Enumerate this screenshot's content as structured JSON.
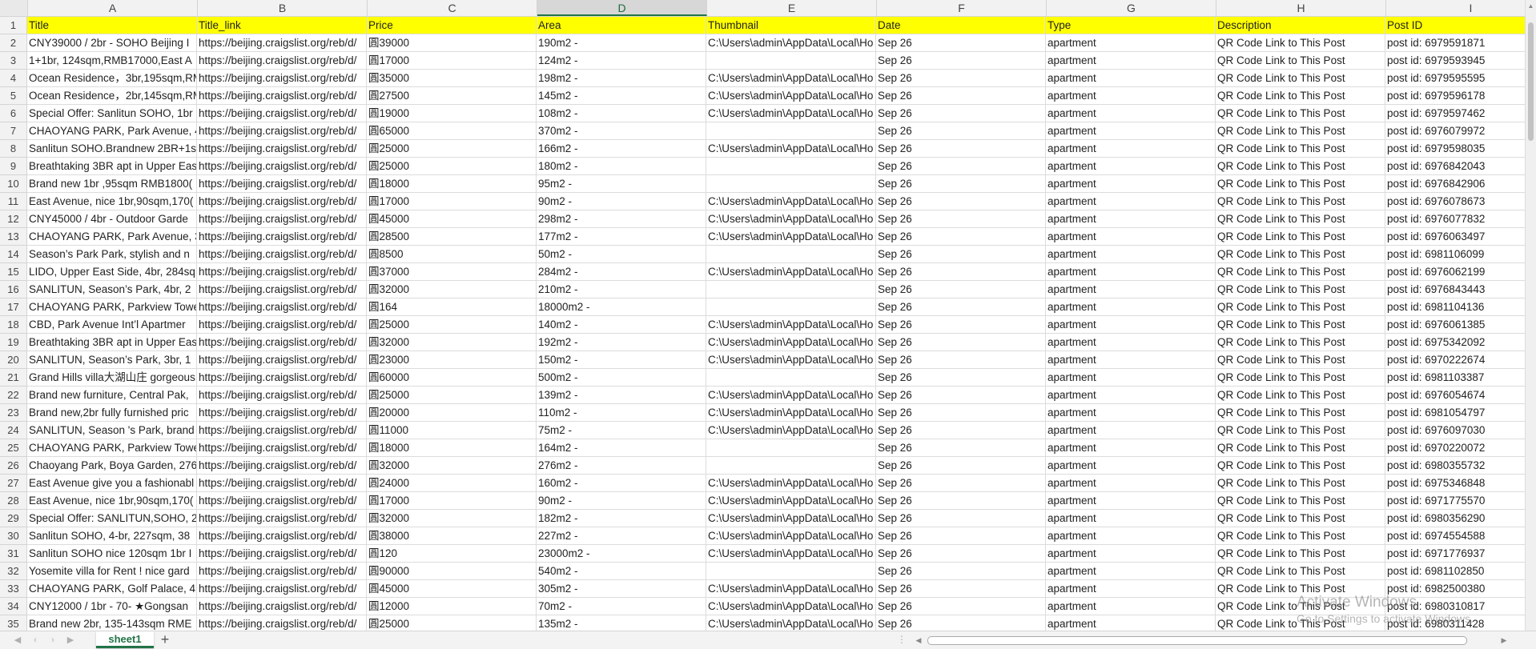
{
  "columns": [
    "A",
    "B",
    "C",
    "D",
    "E",
    "F",
    "G",
    "H",
    "I"
  ],
  "header_row": [
    "Title",
    "Title_link",
    "Price",
    "Area",
    "Thumbnail",
    "Date",
    "Type",
    "Description",
    "Post ID"
  ],
  "rows": [
    [
      "2",
      "CNY39000 / 2br - SOHO Beijing I",
      "https://beijing.craigslist.org/reb/d/",
      "圓39000",
      "190m2 -",
      "C:\\Users\\admin\\AppData\\Local\\Ho",
      "Sep 26",
      "apartment",
      "QR Code Link to This Post",
      "post id: 6979591871"
    ],
    [
      "3",
      "1+1br, 124sqm,RMB17000,East A",
      "https://beijing.craigslist.org/reb/d/",
      "圓17000",
      "124m2 -",
      "",
      "Sep 26",
      "apartment",
      "QR Code Link to This Post",
      "post id: 6979593945"
    ],
    [
      "4",
      "Ocean Residence，3br,195sqm,RM",
      "https://beijing.craigslist.org/reb/d/",
      "圓35000",
      "198m2 -",
      "C:\\Users\\admin\\AppData\\Local\\Ho",
      "Sep 26",
      "apartment",
      "QR Code Link to This Post",
      "post id: 6979595595"
    ],
    [
      "5",
      "Ocean Residence，2br,145sqm,RM",
      "https://beijing.craigslist.org/reb/d/",
      "圓27500",
      "145m2 -",
      "C:\\Users\\admin\\AppData\\Local\\Ho",
      "Sep 26",
      "apartment",
      "QR Code Link to This Post",
      "post id: 6979596178"
    ],
    [
      "6",
      "Special Offer: Sanlitun SOHO, 1br",
      "https://beijing.craigslist.org/reb/d/",
      "圓19000",
      "108m2 -",
      "C:\\Users\\admin\\AppData\\Local\\Ho",
      "Sep 26",
      "apartment",
      "QR Code Link to This Post",
      "post id: 6979597462"
    ],
    [
      "7",
      "CHAOYANG PARK, Park Avenue, 4",
      "https://beijing.craigslist.org/reb/d/",
      "圓65000",
      "370m2 -",
      "",
      "Sep 26",
      "apartment",
      "QR Code Link to This Post",
      "post id: 6976079972"
    ],
    [
      "8",
      "Sanlitun SOHO.Brandnew 2BR+1s",
      "https://beijing.craigslist.org/reb/d/",
      "圓25000",
      "166m2 -",
      "C:\\Users\\admin\\AppData\\Local\\Ho",
      "Sep 26",
      "apartment",
      "QR Code Link to This Post",
      "post id: 6979598035"
    ],
    [
      "9",
      "Breathtaking 3BR apt in Upper Eas",
      "https://beijing.craigslist.org/reb/d/",
      "圓25000",
      "180m2 -",
      "",
      "Sep 26",
      "apartment",
      "QR Code Link to This Post",
      "post id: 6976842043"
    ],
    [
      "10",
      "Brand new 1br ,95sqm RMB1800(",
      "https://beijing.craigslist.org/reb/d/",
      "圓18000",
      "95m2 -",
      "",
      "Sep 26",
      "apartment",
      "QR Code Link to This Post",
      "post id: 6976842906"
    ],
    [
      "11",
      "East Avenue, nice 1br,90sqm,170(",
      "https://beijing.craigslist.org/reb/d/",
      "圓17000",
      "90m2 -",
      "C:\\Users\\admin\\AppData\\Local\\Ho",
      "Sep 26",
      "apartment",
      "QR Code Link to This Post",
      "post id: 6976078673"
    ],
    [
      "12",
      "CNY45000 / 4br - Outdoor Garde",
      "https://beijing.craigslist.org/reb/d/",
      "圓45000",
      "298m2 -",
      "C:\\Users\\admin\\AppData\\Local\\Ho",
      "Sep 26",
      "apartment",
      "QR Code Link to This Post",
      "post id: 6976077832"
    ],
    [
      "13",
      "CHAOYANG PARK, Park Avenue, 3",
      "https://beijing.craigslist.org/reb/d/",
      "圓28500",
      "177m2 -",
      "C:\\Users\\admin\\AppData\\Local\\Ho",
      "Sep 26",
      "apartment",
      "QR Code Link to This Post",
      "post id: 6976063497"
    ],
    [
      "14",
      "Season’s Park Park, stylish and n",
      "https://beijing.craigslist.org/reb/d/",
      "圓8500",
      "50m2 -",
      "",
      "Sep 26",
      "apartment",
      "QR Code Link to This Post",
      "post id: 6981106099"
    ],
    [
      "15",
      "LIDO, Upper East Side, 4br, 284sq",
      "https://beijing.craigslist.org/reb/d/",
      "圓37000",
      "284m2 -",
      "C:\\Users\\admin\\AppData\\Local\\Ho",
      "Sep 26",
      "apartment",
      "QR Code Link to This Post",
      "post id: 6976062199"
    ],
    [
      "16",
      "SANLITUN, Season’s Park, 4br, 2",
      "https://beijing.craigslist.org/reb/d/",
      "圓32000",
      "210m2 -",
      "",
      "Sep 26",
      "apartment",
      "QR Code Link to This Post",
      "post id: 6976843443"
    ],
    [
      "17",
      "CHAOYANG PARK, Parkview Towe",
      "https://beijing.craigslist.org/reb/d/",
      "圓164",
      "18000m2 -",
      "",
      "Sep 26",
      "apartment",
      "QR Code Link to This Post",
      "post id: 6981104136"
    ],
    [
      "18",
      "CBD, Park Avenue Int’l Apartmer",
      "https://beijing.craigslist.org/reb/d/",
      "圓25000",
      "140m2 -",
      "C:\\Users\\admin\\AppData\\Local\\Ho",
      "Sep 26",
      "apartment",
      "QR Code Link to This Post",
      "post id: 6976061385"
    ],
    [
      "19",
      "Breathtaking 3BR apt in Upper Eas",
      "https://beijing.craigslist.org/reb/d/",
      "圓32000",
      "192m2 -",
      "C:\\Users\\admin\\AppData\\Local\\Ho",
      "Sep 26",
      "apartment",
      "QR Code Link to This Post",
      "post id: 6975342092"
    ],
    [
      "20",
      "SANLITUN, Season’s Park, 3br, 1",
      "https://beijing.craigslist.org/reb/d/",
      "圓23000",
      "150m2 -",
      "C:\\Users\\admin\\AppData\\Local\\Ho",
      "Sep 26",
      "apartment",
      "QR Code Link to This Post",
      "post id: 6970222674"
    ],
    [
      "21",
      "Grand Hills villa大湖山庄 gorgeous",
      "https://beijing.craigslist.org/reb/d/",
      "圓60000",
      "500m2 -",
      "",
      "Sep 26",
      "apartment",
      "QR Code Link to This Post",
      "post id: 6981103387"
    ],
    [
      "22",
      "Brand new furniture, Central Pak,",
      "https://beijing.craigslist.org/reb/d/",
      "圓25000",
      "139m2 -",
      "C:\\Users\\admin\\AppData\\Local\\Ho",
      "Sep 26",
      "apartment",
      "QR Code Link to This Post",
      "post id: 6976054674"
    ],
    [
      "23",
      "Brand new,2br fully furnished pric",
      "https://beijing.craigslist.org/reb/d/",
      "圓20000",
      "110m2 -",
      "C:\\Users\\admin\\AppData\\Local\\Ho",
      "Sep 26",
      "apartment",
      "QR Code Link to This Post",
      "post id: 6981054797"
    ],
    [
      "24",
      "SANLITUN, Season 's Park, brand",
      "https://beijing.craigslist.org/reb/d/",
      "圓11000",
      "75m2 -",
      "C:\\Users\\admin\\AppData\\Local\\Ho",
      "Sep 26",
      "apartment",
      "QR Code Link to This Post",
      "post id: 6976097030"
    ],
    [
      "25",
      "CHAOYANG PARK, Parkview Towe",
      "https://beijing.craigslist.org/reb/d/",
      "圓18000",
      "164m2 -",
      "",
      "Sep 26",
      "apartment",
      "QR Code Link to This Post",
      "post id: 6970220072"
    ],
    [
      "26",
      "Chaoyang Park, Boya Garden, 276",
      "https://beijing.craigslist.org/reb/d/",
      "圓32000",
      "276m2 -",
      "",
      "Sep 26",
      "apartment",
      "QR Code Link to This Post",
      "post id: 6980355732"
    ],
    [
      "27",
      "East Avenue give you a fashionabl",
      "https://beijing.craigslist.org/reb/d/",
      "圓24000",
      "160m2 -",
      "C:\\Users\\admin\\AppData\\Local\\Ho",
      "Sep 26",
      "apartment",
      "QR Code Link to This Post",
      "post id: 6975346848"
    ],
    [
      "28",
      "East Avenue, nice 1br,90sqm,170(",
      "https://beijing.craigslist.org/reb/d/",
      "圓17000",
      "90m2 -",
      "C:\\Users\\admin\\AppData\\Local\\Ho",
      "Sep 26",
      "apartment",
      "QR Code Link to This Post",
      "post id: 6971775570"
    ],
    [
      "29",
      "Special Offer: SANLITUN,SOHO, 2",
      "https://beijing.craigslist.org/reb/d/",
      "圓32000",
      "182m2 -",
      "C:\\Users\\admin\\AppData\\Local\\Ho",
      "Sep 26",
      "apartment",
      "QR Code Link to This Post",
      "post id: 6980356290"
    ],
    [
      "30",
      "Sanlitun SOHO, 4-br, 227sqm, 38",
      "https://beijing.craigslist.org/reb/d/",
      "圓38000",
      "227m2 -",
      "C:\\Users\\admin\\AppData\\Local\\Ho",
      "Sep 26",
      "apartment",
      "QR Code Link to This Post",
      "post id: 6974554588"
    ],
    [
      "31",
      "Sanlitun SOHO nice 120sqm 1br I",
      "https://beijing.craigslist.org/reb/d/",
      "圓120",
      "23000m2 -",
      "C:\\Users\\admin\\AppData\\Local\\Ho",
      "Sep 26",
      "apartment",
      "QR Code Link to This Post",
      "post id: 6971776937"
    ],
    [
      "32",
      "Yosemite villa for Rent ! nice gard",
      "https://beijing.craigslist.org/reb/d/",
      "圓90000",
      "540m2 -",
      "",
      "Sep 26",
      "apartment",
      "QR Code Link to This Post",
      "post id: 6981102850"
    ],
    [
      "33",
      "CHAOYANG PARK, Golf Palace, 4I",
      "https://beijing.craigslist.org/reb/d/",
      "圓45000",
      "305m2 -",
      "C:\\Users\\admin\\AppData\\Local\\Ho",
      "Sep 26",
      "apartment",
      "QR Code Link to This Post",
      "post id: 6982500380"
    ],
    [
      "34",
      "CNY12000 / 1br - 70- ★Gongsan",
      "https://beijing.craigslist.org/reb/d/",
      "圓12000",
      "70m2 -",
      "C:\\Users\\admin\\AppData\\Local\\Ho",
      "Sep 26",
      "apartment",
      "QR Code Link to This Post",
      "post id: 6980310817"
    ],
    [
      "35",
      "Brand new 2br, 135-143sqm RME",
      "https://beijing.craigslist.org/reb/d/",
      "圓25000",
      "135m2 -",
      "C:\\Users\\admin\\AppData\\Local\\Ho",
      "Sep 26",
      "apartment",
      "QR Code Link to This Post",
      "post id: 6980311428"
    ]
  ],
  "selected_column": "D",
  "sheet_tab": "sheet1",
  "add_sheet_symbol": "+",
  "watermark": {
    "line1": "Activate Windows",
    "line2": "Go to Settings to activate Windows."
  },
  "colors": {
    "header_fill": "#ffff00",
    "accent": "#217346"
  }
}
